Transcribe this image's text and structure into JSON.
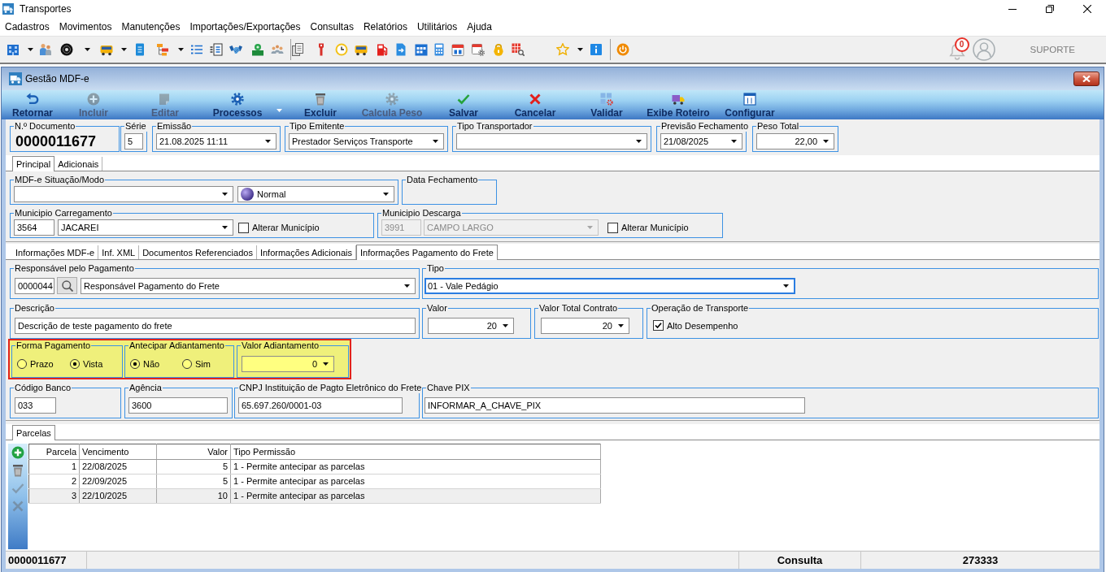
{
  "app": {
    "title": "Transportes"
  },
  "menu": [
    "Cadastros",
    "Movimentos",
    "Manutenções",
    "Importações/Exportações",
    "Consultas",
    "Relatórios",
    "Utilitários",
    "Ajuda"
  ],
  "user": {
    "notifications": "0",
    "name": "SUPORTE"
  },
  "window": {
    "title": "Gestão MDF-e"
  },
  "actions": [
    {
      "label": "Retornar",
      "disabled": false,
      "dropdown": false
    },
    {
      "label": "Incluir",
      "disabled": true,
      "dropdown": false
    },
    {
      "label": "Editar",
      "disabled": true,
      "dropdown": false
    },
    {
      "label": "Processos",
      "disabled": false,
      "dropdown": true
    },
    {
      "label": "Excluir",
      "disabled": false,
      "dropdown": false
    },
    {
      "label": "Calcula Peso",
      "disabled": true,
      "dropdown": false
    },
    {
      "label": "Salvar",
      "disabled": false,
      "dropdown": false
    },
    {
      "label": "Cancelar",
      "disabled": false,
      "dropdown": false
    },
    {
      "label": "Validar",
      "disabled": false,
      "dropdown": false
    },
    {
      "label": "Exibe Roteiro",
      "disabled": false,
      "dropdown": false
    },
    {
      "label": "Configurar",
      "disabled": false,
      "dropdown": false
    }
  ],
  "header": [
    {
      "label": "N.º Documento",
      "fields": [
        {
          "kind": "display",
          "value": "0000011677"
        }
      ]
    },
    {
      "label": "Série",
      "fields": [
        {
          "kind": "input",
          "value": "5",
          "disabled": false,
          "focused": false
        }
      ]
    },
    {
      "label": "Emissão",
      "fields": [
        {
          "kind": "combo",
          "value": "21.08.2025 11:11",
          "disabled": false,
          "focused": false
        }
      ]
    },
    {
      "label": "Tipo Emitente",
      "fields": [
        {
          "kind": "combo",
          "value": "Prestador Serviços Transporte",
          "disabled": false,
          "focused": false
        }
      ]
    },
    {
      "label": "Tipo Transportador",
      "fields": [
        {
          "kind": "combo",
          "disabled": false,
          "focused": false
        }
      ]
    },
    {
      "label": "Previsão Fechamento",
      "fields": [
        {
          "kind": "combo",
          "value": "21/08/2025",
          "disabled": false,
          "focused": false
        }
      ]
    },
    {
      "label": "Peso Total",
      "fields": [
        {
          "kind": "numcombo",
          "value": "22,00",
          "disabled": false,
          "focused": false
        }
      ]
    }
  ],
  "main_tabs": [
    {
      "label": "Principal",
      "selected": true
    },
    {
      "label": "Adicionais",
      "selected": false
    }
  ],
  "principal": [
    {
      "groups": [
        {
          "label": "MDF-e Situação/Modo",
          "fields": [
            {
              "kind": "combo",
              "disabled": false,
              "focused": false
            },
            {
              "kind": "iconcombo",
              "value": "Normal",
              "disabled": false,
              "focused": false
            }
          ]
        },
        {
          "label": "Data Fechamento"
        }
      ]
    },
    {
      "groups": [
        {
          "label": "Municipio Carregamento",
          "fields": [
            {
              "kind": "input",
              "value": "3564",
              "disabled": false,
              "focused": false
            },
            {
              "kind": "combo",
              "value": "JACAREI",
              "disabled": false,
              "focused": false
            },
            {
              "kind": "checkbox",
              "label": "Alterar Município",
              "checked": false
            }
          ]
        },
        {
          "label": "Municipio Descarga",
          "fields": [
            {
              "kind": "input",
              "value": "3991",
              "disabled": true,
              "focused": false
            },
            {
              "kind": "combo",
              "value": "CAMPO LARGO",
              "disabled": true,
              "focused": false
            },
            {
              "kind": "checkbox",
              "label": "Alterar Município",
              "checked": false
            }
          ]
        }
      ]
    }
  ],
  "detail_tabs": [
    {
      "label": "Informações MDF-e",
      "selected": false
    },
    {
      "label": "Inf. XML",
      "selected": false
    },
    {
      "label": "Documentos Referenciados",
      "selected": false
    },
    {
      "label": "Informações Adicionais",
      "selected": false
    },
    {
      "label": "Informações Pagamento do Frete",
      "selected": true
    }
  ],
  "payment": [
    {
      "highlight": false,
      "groups": [
        {
          "label": "Responsável pelo Pagamento",
          "fields": [
            {
              "kind": "input",
              "value": "0000044",
              "disabled": false,
              "focused": false
            },
            {
              "kind": "lookup"
            },
            {
              "kind": "combo",
              "value": "Responsável Pagamento do Frete",
              "disabled": false,
              "focused": false
            }
          ]
        },
        {
          "label": "Tipo",
          "fields": [
            {
              "kind": "combo",
              "value": "01 - Vale Pedágio",
              "disabled": false,
              "focused": true
            }
          ]
        }
      ]
    },
    {
      "highlight": false,
      "groups": [
        {
          "label": "Descrição",
          "fields": [
            {
              "kind": "input",
              "value": "Descrição de teste pagamento do frete",
              "disabled": false,
              "focused": false
            }
          ]
        },
        {
          "label": "Valor",
          "fields": [
            {
              "kind": "numcombo",
              "value": "20",
              "disabled": false,
              "focused": false
            }
          ]
        },
        {
          "label": "Valor Total Contrato",
          "fields": [
            {
              "kind": "numcombo",
              "value": "20",
              "disabled": false,
              "focused": false
            }
          ]
        },
        {
          "label": "Operação de Transporte",
          "fields": [
            {
              "kind": "checkbox",
              "label": "Alto Desempenho",
              "checked": true
            }
          ]
        }
      ]
    },
    {
      "highlight": true,
      "groups": [
        {
          "label": "Forma Pagamento",
          "fields": [
            {
              "kind": "radio",
              "label": "Prazo",
              "selected": false
            },
            {
              "kind": "radio",
              "label": "Vista",
              "selected": true
            }
          ]
        },
        {
          "label": "Antecipar Adiantamento",
          "fields": [
            {
              "kind": "radio",
              "label": "Não",
              "selected": true
            },
            {
              "kind": "radio",
              "label": "Sim",
              "selected": false
            }
          ]
        },
        {
          "label": "Valor Adiantamento",
          "fields": [
            {
              "kind": "numcombo",
              "value": "0",
              "disabled": false,
              "focused": false
            }
          ]
        }
      ]
    },
    {
      "highlight": false,
      "groups": [
        {
          "label": "Código Banco",
          "fields": [
            {
              "kind": "input",
              "value": "033",
              "disabled": false,
              "focused": false
            }
          ]
        },
        {
          "label": "Agência",
          "fields": [
            {
              "kind": "input",
              "value": "3600",
              "disabled": false,
              "focused": false
            }
          ]
        },
        {
          "label": "CNPJ Instituição de Pagto Eletrônico do Frete",
          "fields": [
            {
              "kind": "input",
              "value": "65.697.260/0001-03",
              "disabled": false,
              "focused": false
            }
          ]
        },
        {
          "label": "Chave PIX",
          "fields": [
            {
              "kind": "input",
              "value": "INFORMAR_A_CHAVE_PIX",
              "disabled": false,
              "focused": false
            }
          ]
        }
      ]
    }
  ],
  "parcelas": {
    "tabs": [
      {
        "label": "Parcelas",
        "selected": true
      }
    ],
    "tools": [
      {
        "disabled": false
      },
      {
        "disabled": false
      },
      {
        "disabled": true
      },
      {
        "disabled": true
      }
    ],
    "columns": [
      "Parcela",
      "Vencimento",
      "Valor",
      "Tipo Permissão"
    ],
    "rows": [
      {
        "cells": [
          "1",
          "22/08/2025",
          "5",
          "1 - Permite antecipar as parcelas"
        ],
        "selected": false
      },
      {
        "cells": [
          "2",
          "22/09/2025",
          "5",
          "1 - Permite antecipar as parcelas"
        ],
        "selected": false
      },
      {
        "cells": [
          "3",
          "22/10/2025",
          "10",
          "1 - Permite antecipar as parcelas"
        ],
        "selected": true
      }
    ]
  },
  "status_bar": [
    "0000011677",
    "Consulta",
    "273333"
  ]
}
